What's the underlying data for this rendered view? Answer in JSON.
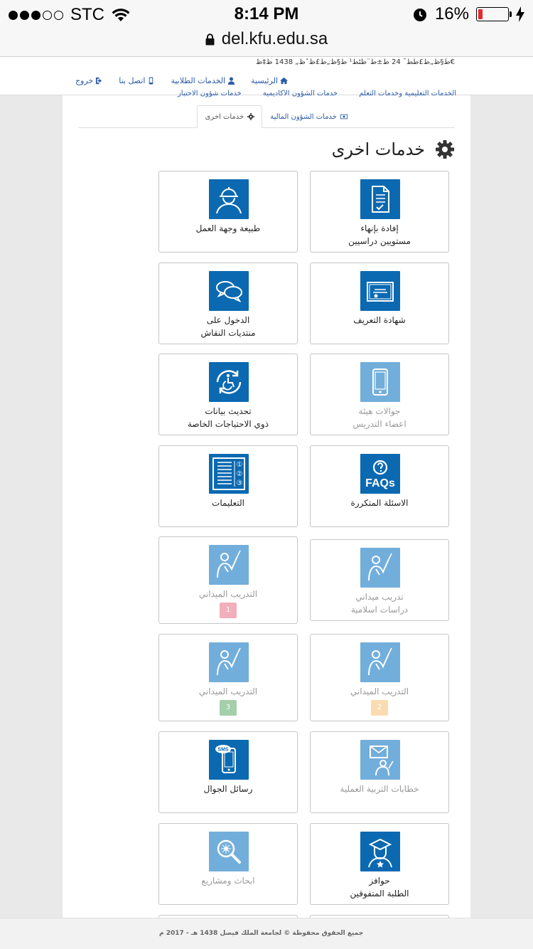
{
  "status_bar": {
    "carrier": "STC",
    "time": "8:14 PM",
    "battery_pct": "16%",
    "battery_level": 0.16,
    "battery_color": "#e8262d"
  },
  "browser": {
    "url": "del.kfu.edu.sa"
  },
  "header": {
    "garbled_date": "ط§ظ„ط£ط­ط¯ 24 ط±ط¨ظٹط¹ ط§ظ„ط£ظˆظ„ 1438 ظ‡ظ€",
    "nav": [
      {
        "label": "الرئيسية",
        "icon": "home-icon"
      },
      {
        "label": "الخدمات الطلابية",
        "icon": "user-icon"
      },
      {
        "label": "اتصل بنا",
        "icon": "mobile-icon"
      },
      {
        "label": "خروج",
        "icon": "logout-icon"
      }
    ]
  },
  "panel": {
    "clipped_tabs": [
      "الخدمات التعليمية وخدمات التعلم",
      "خدمات الشؤون الأكاديمية",
      "خدمات شؤون الاختبار"
    ],
    "tabs": [
      {
        "label": "خدمات الشؤون المالية",
        "icon": "money-icon",
        "active": false
      },
      {
        "label": "خدمات اخرى",
        "icon": "gear-icon",
        "active": true
      }
    ],
    "title": "خدمات اخرى"
  },
  "cards": [
    {
      "label": "إفادة بإنهاء\nمستويين دراسيين",
      "icon": "document-check-icon",
      "dim": false
    },
    {
      "label": "طبيعة وجهة العمل",
      "icon": "worker-helmet-icon",
      "dim": false
    },
    {
      "label": "شهادة التعريف",
      "icon": "certificate-icon",
      "dim": false
    },
    {
      "label": "الدخول على\nمنتديات النقاش",
      "icon": "chat-bubbles-icon",
      "dim": false
    },
    {
      "label": "جوالات هيئة\nاعضاء التدريس",
      "icon": "smartphone-icon",
      "dim": true
    },
    {
      "label": "تحديث بيانات\nذوي الاحتياجات الخاصة",
      "icon": "wheelchair-refresh-icon",
      "dim": false
    },
    {
      "label": "الاسئلة المتكررة",
      "icon": "faq-icon",
      "dim": false,
      "icon_text": "FAQs"
    },
    {
      "label": "التعليمات",
      "icon": "instructions-list-icon",
      "dim": false,
      "marks": [
        "①",
        "②",
        "③"
      ]
    },
    {
      "label": "تدريب ميداني\nدراسات اسلامية",
      "icon": "teacher-pointer-icon",
      "dim": true
    },
    {
      "label": "التدريب الميداني",
      "icon": "teacher-pointer-icon",
      "dim": true,
      "badge": "1",
      "badge_color": "#f3aebb"
    },
    {
      "label": "التدريب الميداني",
      "icon": "teacher-pointer-icon",
      "dim": true,
      "badge": "2",
      "badge_color": "#fbdcb0"
    },
    {
      "label": "التدريب الميداني",
      "icon": "teacher-pointer-icon",
      "dim": true,
      "badge": "3",
      "badge_color": "#a3cfa9"
    },
    {
      "label": "خطابات التربية العملية",
      "icon": "envelope-teacher-icon",
      "dim": true
    },
    {
      "label": "رسائل الجوال",
      "icon": "sms-phone-icon",
      "dim": false,
      "icon_text": "SMS"
    },
    {
      "label": "حوافز\nالطلبة المتفوقين",
      "icon": "graduate-star-icon",
      "dim": false
    },
    {
      "label": "ابحاث ومشاريع",
      "icon": "research-magnifier-icon",
      "dim": true
    }
  ],
  "footer": {
    "text": "جميع الحقوق محفوظة © لجامعة الملك فيصل 1438 هـ - 2017 م"
  }
}
